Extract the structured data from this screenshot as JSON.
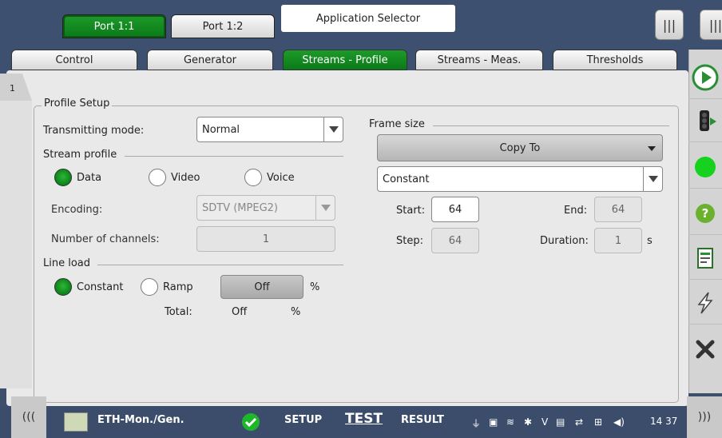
{
  "ports": {
    "active": "Port 1:1",
    "inactive": "Port 1:2"
  },
  "app_selector": "Application Selector",
  "tabs": [
    {
      "label": "Control"
    },
    {
      "label": "Generator"
    },
    {
      "label": "Streams - Profile"
    },
    {
      "label": "Streams - Meas."
    },
    {
      "label": "Thresholds"
    }
  ],
  "side_number": "1",
  "profile_setup": {
    "title": "Profile Setup",
    "transmitting_mode": {
      "label": "Transmitting mode:",
      "value": "Normal"
    },
    "stream_profile": {
      "title": "Stream profile",
      "options": [
        "Data",
        "Video",
        "Voice"
      ],
      "selected": "Data",
      "encoding": {
        "label": "Encoding:",
        "value": "SDTV (MPEG2)"
      },
      "channels": {
        "label": "Number of channels:",
        "value": "1"
      }
    },
    "line_load": {
      "title": "Line load",
      "options": [
        "Constant",
        "Ramp"
      ],
      "selected": "Constant",
      "value": "Off",
      "unit": "%",
      "total_label": "Total:",
      "total_value": "Off",
      "total_unit": "%"
    },
    "frame_size": {
      "title": "Frame size",
      "copy_to": "Copy To",
      "mode": "Constant",
      "start_label": "Start:",
      "start_value": "64",
      "end_label": "End:",
      "end_value": "64",
      "step_label": "Step:",
      "step_value": "64",
      "duration_label": "Duration:",
      "duration_value": "1",
      "duration_unit": "s"
    }
  },
  "bottom": {
    "nav_left": "(((",
    "nav_right": ")))",
    "app_name": "ETH-Mon./Gen.",
    "setup": "SETUP",
    "test": "TEST",
    "result": "RESULT",
    "time": "14 37"
  },
  "colors": {
    "accent_green": "#0e8a1b",
    "background": "#3d4f69"
  }
}
